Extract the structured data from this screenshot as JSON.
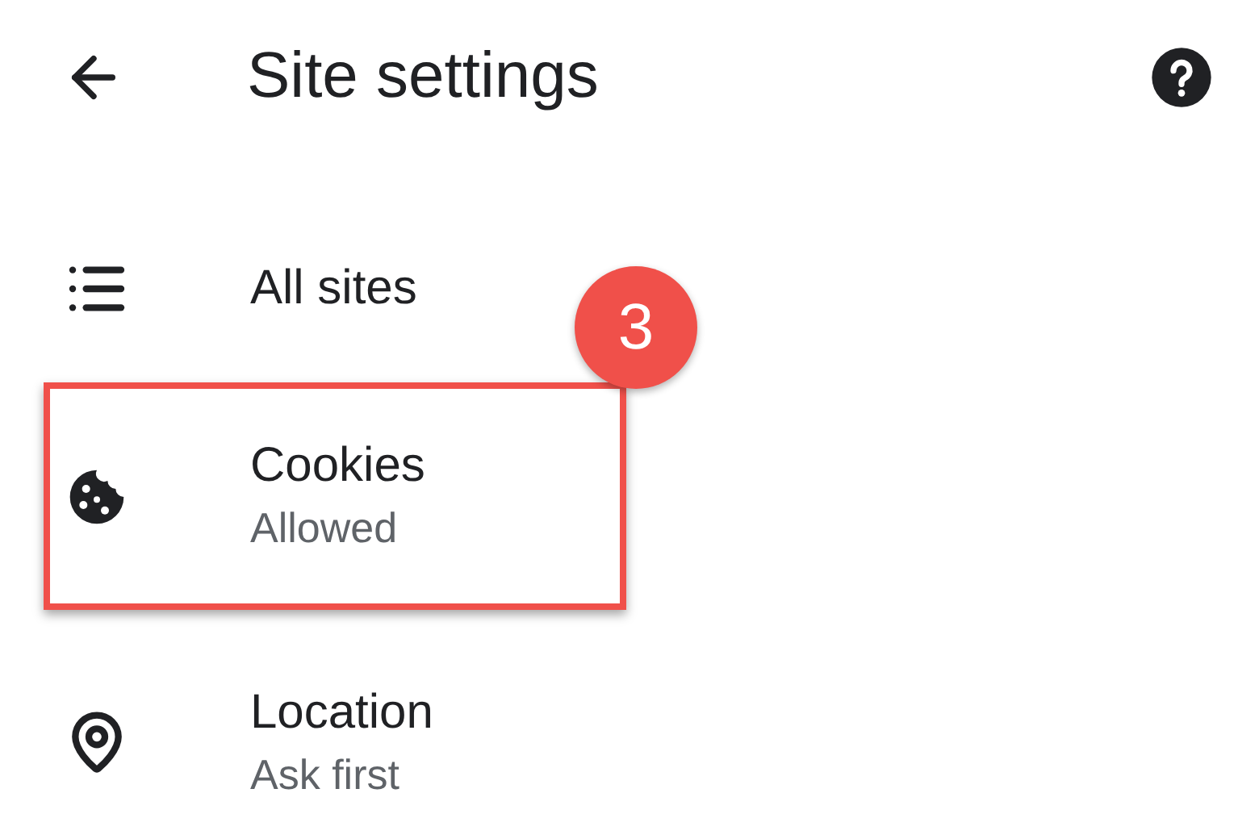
{
  "header": {
    "title": "Site settings"
  },
  "items": [
    {
      "title": "All sites",
      "highlighted": false
    },
    {
      "title": "Cookies",
      "subtitle": "Allowed",
      "highlighted": true,
      "badge": "3"
    },
    {
      "title": "Location",
      "subtitle": "Ask first",
      "highlighted": false
    }
  ]
}
